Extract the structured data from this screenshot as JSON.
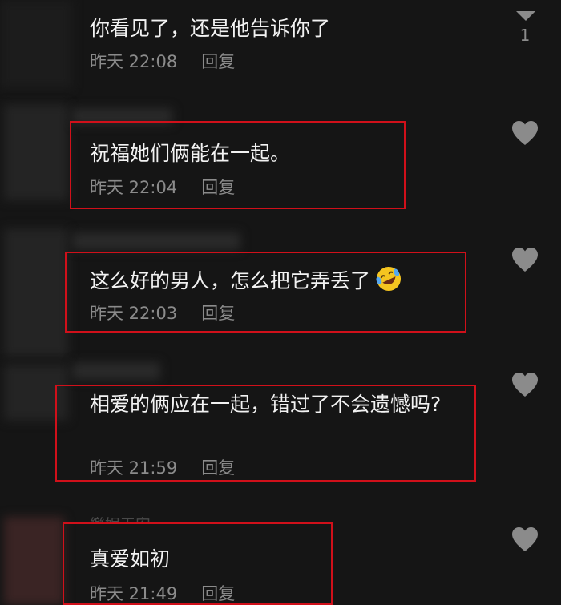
{
  "comments": [
    {
      "text": "你看见了，还是他告诉你了",
      "time": "昨天 22:08",
      "reply": "回复",
      "likes": "1"
    },
    {
      "text": "祝福她们俩能在一起。",
      "time": "昨天 22:04",
      "reply": "回复"
    },
    {
      "text": "这么好的男人，怎么把它弄丢了",
      "time": "昨天 22:03",
      "reply": "回复",
      "emoji": "rofl-emoji"
    },
    {
      "text": "相爱的俩应在一起，错过了不会遗憾吗?",
      "time": "昨天 21:59",
      "reply": "回复"
    },
    {
      "text": "真爱如初",
      "time": "昨天 21:49",
      "reply": "回复"
    }
  ],
  "partial_username": "樂娱天安",
  "colors": {
    "background": "#151515",
    "highlight": "#d0101a",
    "meta": "#8b8b8b",
    "text": "#f2f2f2"
  },
  "icons": {
    "like": "heart-icon",
    "dislike_indicator": "triangle-down-icon"
  }
}
